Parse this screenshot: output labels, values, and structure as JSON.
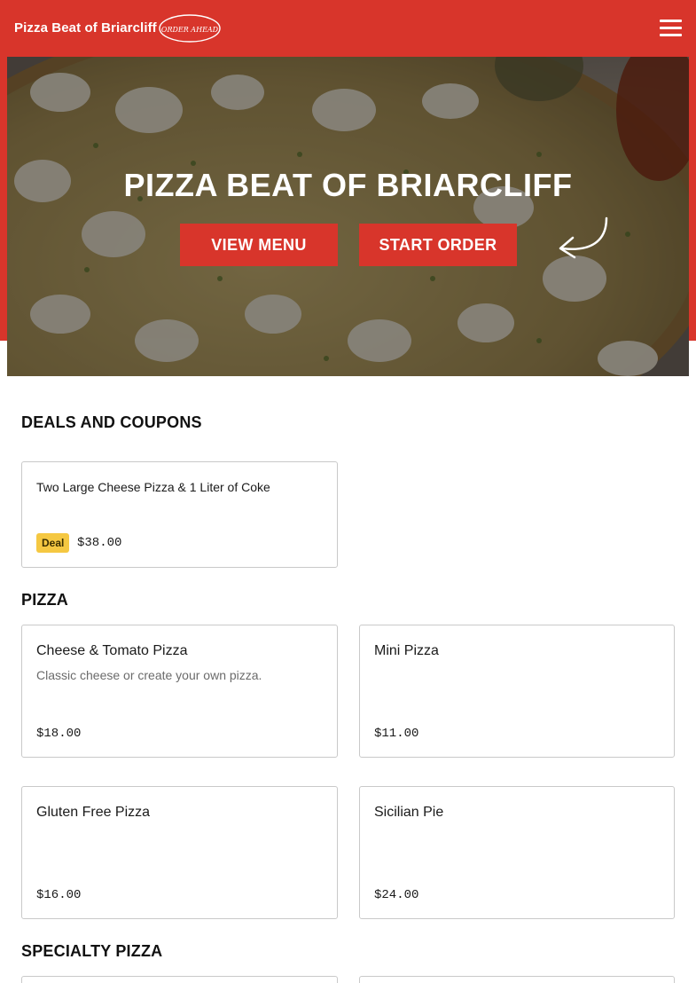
{
  "header": {
    "brand": "Pizza Beat of Briarcliff",
    "order_badge": "ORDER AHEAD",
    "colors": {
      "primary": "#d8352b",
      "deal_badge": "#f5c842"
    }
  },
  "hero": {
    "title": "PIZZA BEAT OF BRIARCLIFF",
    "view_menu_label": "VIEW MENU",
    "start_order_label": "START ORDER"
  },
  "sections": {
    "deals": {
      "title": "DEALS AND COUPONS",
      "items": [
        {
          "name": "Two Large Cheese Pizza & 1 Liter of Coke",
          "badge": "Deal",
          "price": "$38.00"
        }
      ]
    },
    "pizza": {
      "title": "PIZZA",
      "items": [
        {
          "name": "Cheese & Tomato Pizza",
          "description": "Classic cheese or create your own pizza.",
          "price": "$18.00"
        },
        {
          "name": "Mini Pizza",
          "description": "",
          "price": "$11.00"
        },
        {
          "name": "Gluten Free Pizza",
          "description": "",
          "price": "$16.00"
        },
        {
          "name": "Sicilian Pie",
          "description": "",
          "price": "$24.00"
        }
      ]
    },
    "specialty": {
      "title": "SPECIALTY PIZZA"
    }
  }
}
